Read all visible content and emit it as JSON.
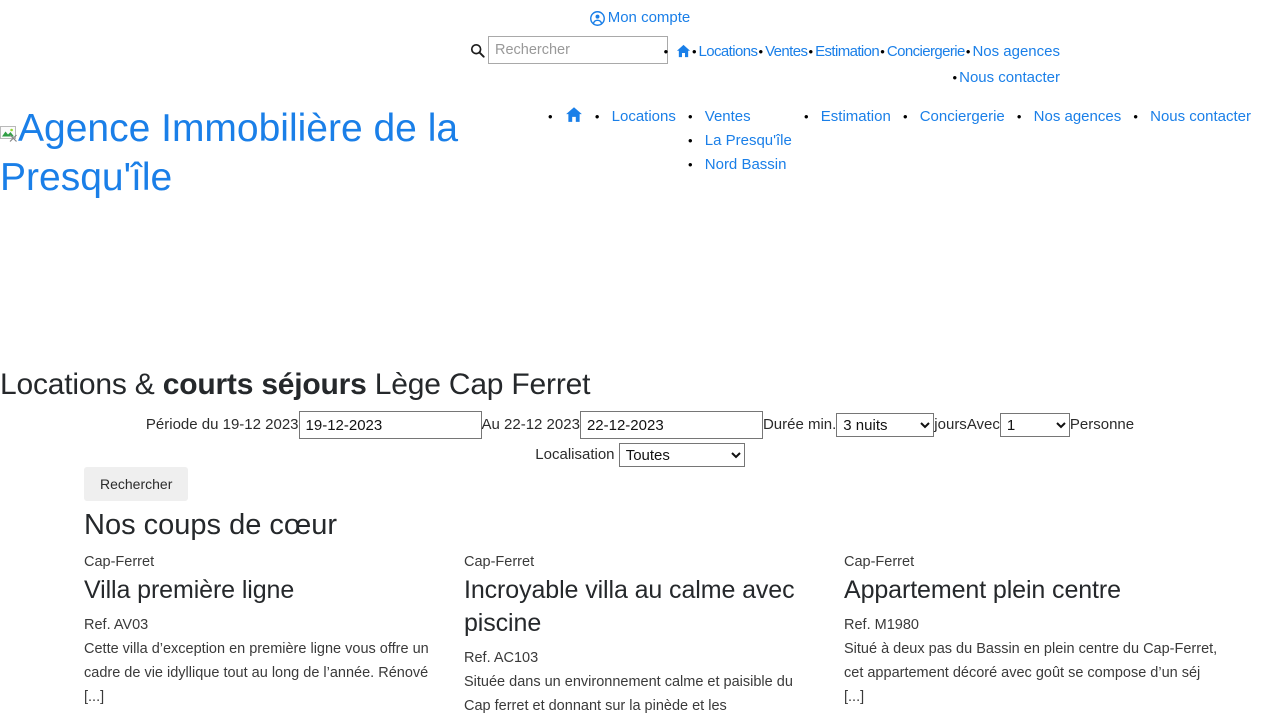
{
  "utility": {
    "account_label": "Mon compte",
    "account_icon": "user-circle-icon"
  },
  "search": {
    "icon": "search-icon",
    "placeholder": "Rechercher",
    "value": ""
  },
  "squashed_nav": {
    "home_icon": "home-icon",
    "items": [
      {
        "label": "Locations"
      },
      {
        "label": "Ventes"
      },
      {
        "label": "Estimation"
      },
      {
        "label": "Conciergerie"
      },
      {
        "label": "Nos agences"
      },
      {
        "label": "Nous contacter"
      }
    ]
  },
  "logo": {
    "broken_image_icon": "broken-image-icon",
    "alt_text": "Agence Immobilière de la Presqu'île"
  },
  "main_nav": {
    "home_icon": "home-icon",
    "items": [
      {
        "label": "Locations"
      },
      {
        "label": "Ventes"
      },
      {
        "label": "Estimation"
      },
      {
        "label": "Conciergerie"
      },
      {
        "label": "Nos agences"
      },
      {
        "label": "Nous contacter"
      }
    ],
    "ventes_submenu": [
      {
        "label": "La Presqu'île"
      },
      {
        "label": "Nord Bassin"
      }
    ]
  },
  "page": {
    "title_part1": "Locations & ",
    "title_bold": "courts séjours",
    "title_part2": " Lège Cap Ferret"
  },
  "booking": {
    "period_label": "Période du 19-12 2023",
    "date_from_value": "19-12-2023",
    "to_label": "Au 22-12 2023",
    "date_to_value": "22-12-2023",
    "duration_label": "Durée min.",
    "duration_value": "3 nuits",
    "duration_options": [
      "3 nuits"
    ],
    "days_label": "jours",
    "with_label": "Avec",
    "persons_value": "1",
    "persons_options": [
      "1"
    ],
    "persons_label": "Personne",
    "location_label": "Localisation",
    "location_value": "Toutes",
    "location_options": [
      "Toutes"
    ],
    "submit_label": "Rechercher"
  },
  "featured": {
    "section_title": "Nos coups de cœur",
    "cards": [
      {
        "location": "Cap-Ferret",
        "title": "Villa première ligne",
        "ref": "Ref. AV03",
        "description": "Cette villa d’exception en première ligne vous offre un cadre de vie idyllique tout au long de l’année. Rénové [...]"
      },
      {
        "location": "Cap-Ferret",
        "title": "Incroyable villa au calme avec piscine",
        "ref": "Ref. AC103",
        "description": "Située dans un environnement calme et paisible du Cap ferret et donnant sur la pinède et les"
      },
      {
        "location": "Cap-Ferret",
        "title": "Appartement plein centre",
        "ref": "Ref. M1980",
        "description": "Situé à deux pas du Bassin en plein centre du Cap-Ferret, cet appartement décoré avec goût se compose d’un séj [...]"
      }
    ]
  },
  "colors": {
    "link": "#1a7fe8",
    "text": "#25282b",
    "button_bg": "#efefef"
  }
}
